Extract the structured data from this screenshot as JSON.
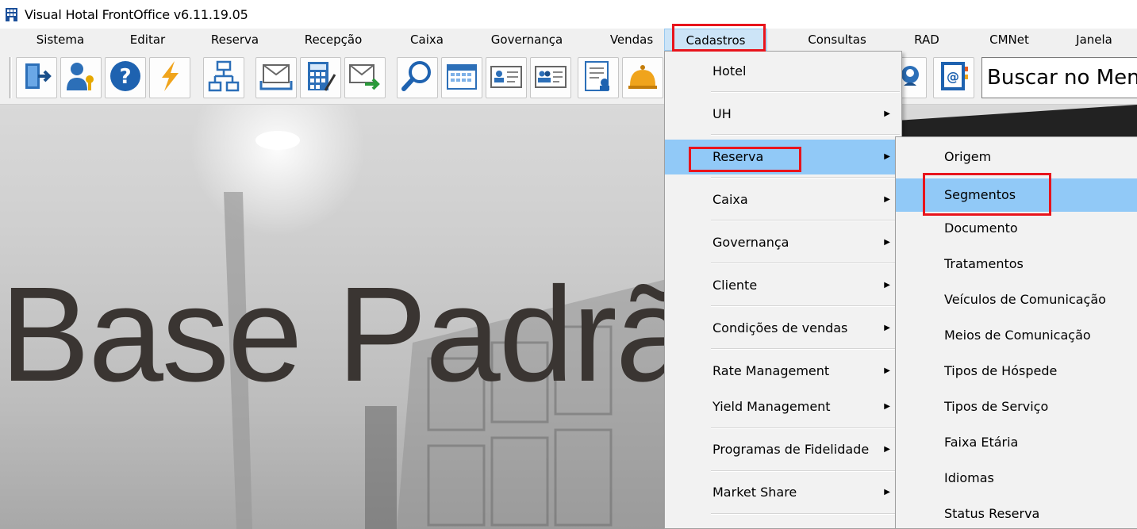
{
  "window": {
    "title": "Visual Hotal FrontOffice v6.11.19.05"
  },
  "menubar": {
    "items": [
      {
        "label": "Sistema"
      },
      {
        "label": "Editar"
      },
      {
        "label": "Reserva"
      },
      {
        "label": "Recepção"
      },
      {
        "label": "Caixa"
      },
      {
        "label": "Governança"
      },
      {
        "label": "Vendas"
      },
      {
        "label": "Cadastros"
      },
      {
        "label": "Consultas"
      },
      {
        "label": "RAD"
      },
      {
        "label": "CMNet"
      },
      {
        "label": "Janela"
      }
    ],
    "active": "Cadastros"
  },
  "toolbar": {
    "buttons": [
      {
        "icon": "exit-door-icon"
      },
      {
        "icon": "user-key-icon"
      },
      {
        "icon": "help-icon"
      },
      {
        "icon": "lightning-icon"
      },
      {
        "icon": "org-chart-icon"
      },
      {
        "icon": "mail-tray-icon"
      },
      {
        "icon": "calculator-icon"
      },
      {
        "icon": "send-mail-icon"
      },
      {
        "icon": "search-icon"
      },
      {
        "icon": "calendar-icon"
      },
      {
        "icon": "guest-card-icon"
      },
      {
        "icon": "group-card-icon"
      },
      {
        "icon": "report-icon"
      },
      {
        "icon": "bell-icon"
      },
      {
        "icon": "contact-support-icon"
      },
      {
        "icon": "address-book-icon"
      }
    ],
    "search_value": "Buscar no Menu"
  },
  "background": {
    "text": "Base Padrão"
  },
  "cadastros_menu": {
    "items": [
      {
        "label": "Hotel",
        "has_submenu": false
      },
      {
        "label": "UH",
        "has_submenu": true
      },
      {
        "label": "Reserva",
        "has_submenu": true
      },
      {
        "label": "Caixa",
        "has_submenu": true
      },
      {
        "label": "Governança",
        "has_submenu": true
      },
      {
        "label": "Cliente",
        "has_submenu": true
      },
      {
        "label": "Condições de vendas",
        "has_submenu": true
      },
      {
        "label": "Rate Management",
        "has_submenu": true
      },
      {
        "label": "Yield Management",
        "has_submenu": true
      },
      {
        "label": "Programas de Fidelidade",
        "has_submenu": true
      },
      {
        "label": "Market Share",
        "has_submenu": true
      }
    ],
    "selected": "Reserva",
    "arrow_glyph": "▶"
  },
  "reserva_submenu": {
    "items": [
      {
        "label": "Origem"
      },
      {
        "label": "Segmentos"
      },
      {
        "label": "Documento"
      },
      {
        "label": "Tratamentos"
      },
      {
        "label": "Veículos de Comunicação"
      },
      {
        "label": "Meios de Comunicação"
      },
      {
        "label": "Tipos de Hóspede"
      },
      {
        "label": "Tipos de Serviço"
      },
      {
        "label": "Faixa Etária"
      },
      {
        "label": "Idiomas"
      },
      {
        "label": "Status Reserva"
      }
    ],
    "selected": "Segmentos"
  },
  "colors": {
    "highlight_box": "#e8141c",
    "menu_selected": "#91c9f7",
    "menubar_active": "#cce4f7"
  }
}
